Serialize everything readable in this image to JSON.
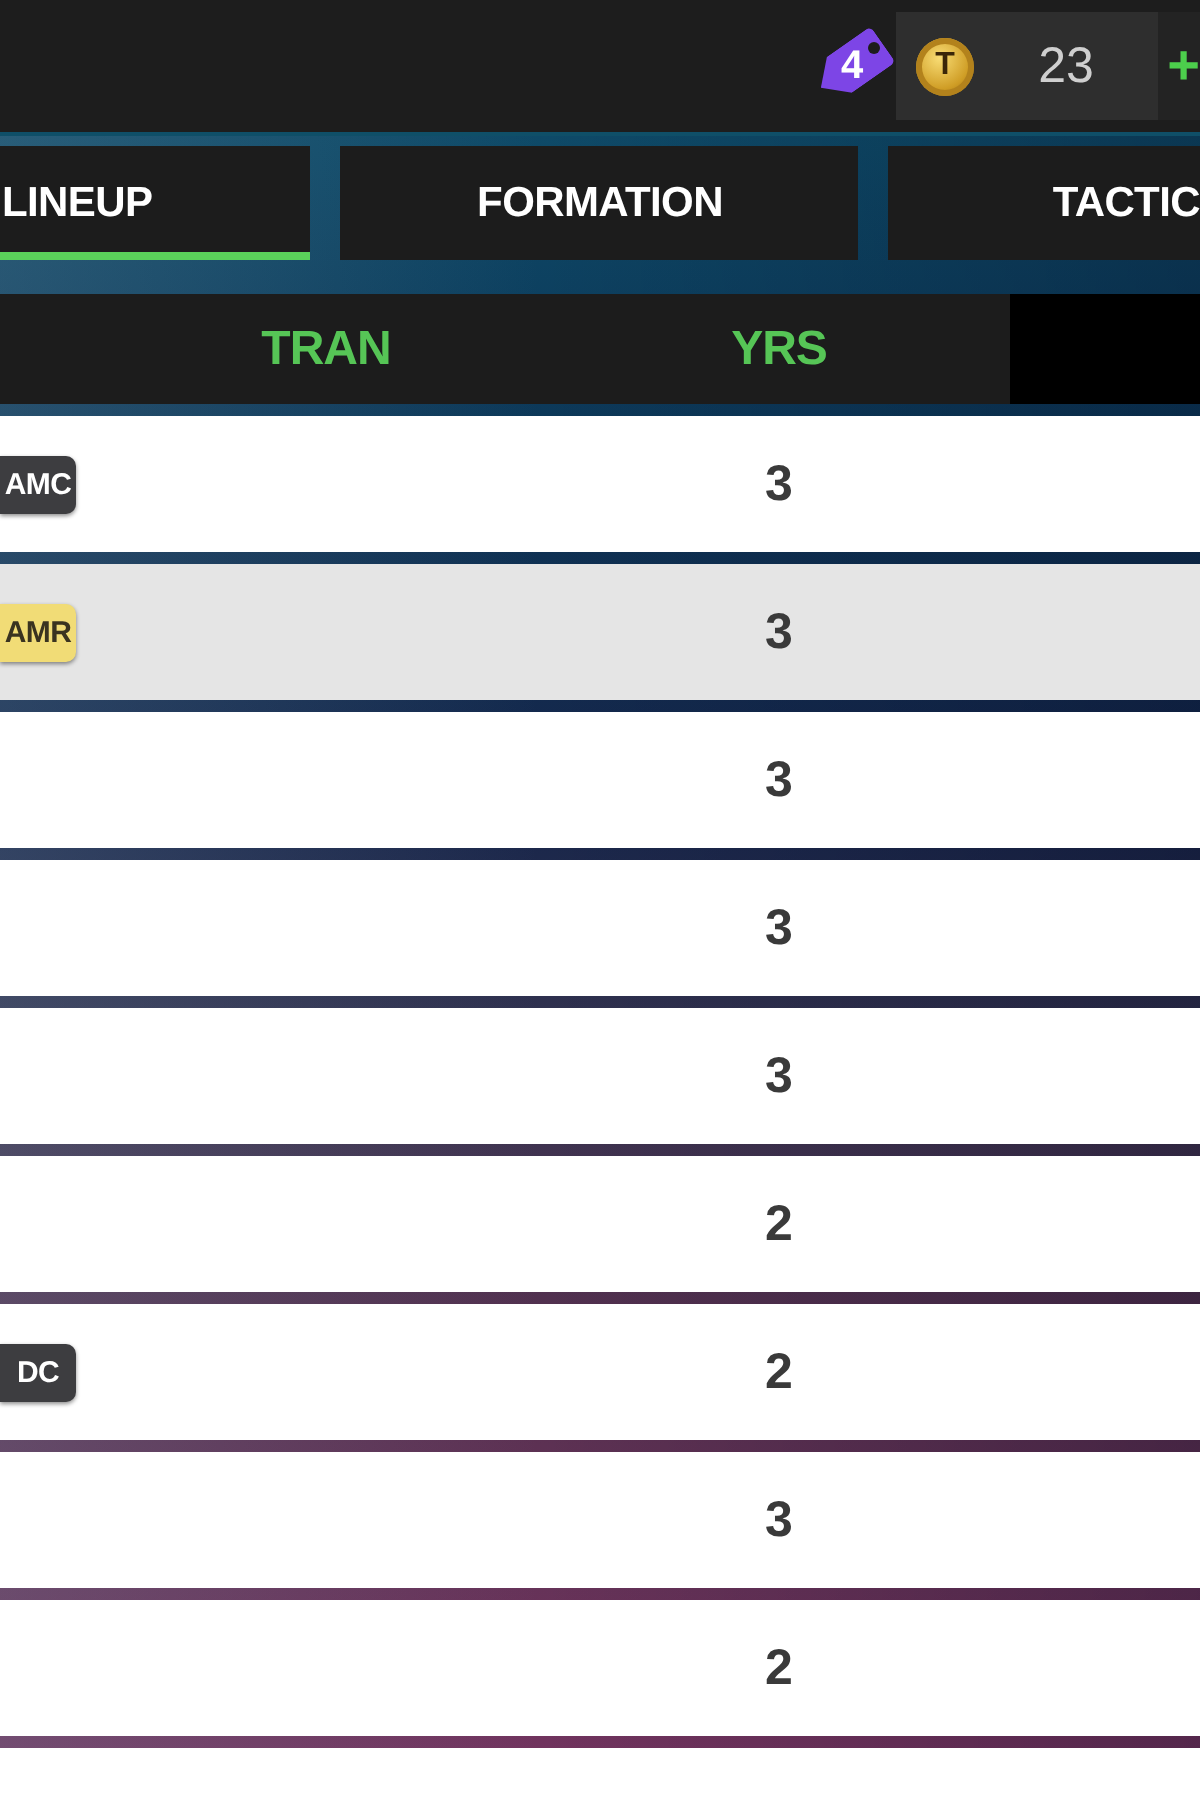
{
  "top_bar": {
    "tag_count": "4",
    "coin_symbol": "T",
    "coins": "23",
    "add_label": "+"
  },
  "tabs": [
    {
      "label": "LINEUP",
      "selected": true
    },
    {
      "label": "FORMATION",
      "selected": false
    },
    {
      "label": "TACTIC",
      "selected": false
    }
  ],
  "table": {
    "columns": [
      {
        "label": "TRAN"
      },
      {
        "label": "YRS"
      }
    ],
    "rows": [
      {
        "position": {
          "label": "AMC",
          "color": "#3d3d40"
        },
        "yrs": "3",
        "selected": false
      },
      {
        "position": {
          "label": "AMR",
          "color": "#f1dc76"
        },
        "yrs": "3",
        "selected": true
      },
      {
        "yrs": "3",
        "selected": false
      },
      {
        "yrs": "3",
        "selected": false
      },
      {
        "yrs": "3",
        "selected": false
      },
      {
        "yrs": "2",
        "selected": false
      },
      {
        "position": {
          "label": "DC",
          "color": "#3d3d40"
        },
        "yrs": "2",
        "selected": false
      },
      {
        "yrs": "3",
        "selected": false
      },
      {
        "yrs": "2",
        "selected": false
      }
    ]
  }
}
